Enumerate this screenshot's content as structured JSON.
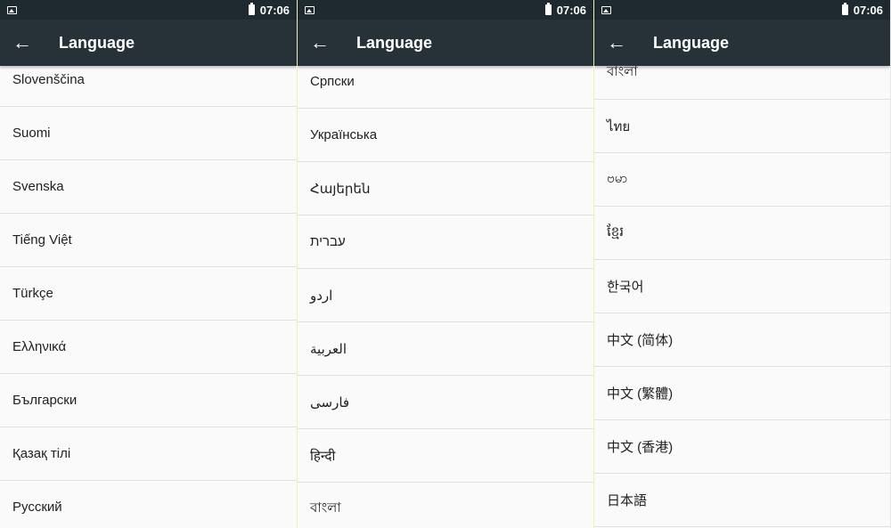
{
  "status_bar": {
    "time": "07:06"
  },
  "screens": [
    {
      "title": "Language",
      "items": [
        "Slovenščina",
        "Suomi",
        "Svenska",
        "Tiếng Việt",
        "Türkçe",
        "Ελληνικά",
        "Български",
        "Қазақ тілі",
        "Русский"
      ]
    },
    {
      "title": "Language",
      "items": [
        "Српски",
        "Українська",
        "Հայերեն",
        "עברית",
        "اردو",
        "العربية",
        "فارسی",
        "हिन्दी",
        "বাংলা"
      ]
    },
    {
      "title": "Language",
      "items": [
        "বাংলা",
        "ไทย",
        "ဗမာ",
        "ខ្មែរ",
        "한국어",
        "中文 (简体)",
        "中文 (繁體)",
        "中文 (香港)",
        "日本語"
      ]
    }
  ]
}
